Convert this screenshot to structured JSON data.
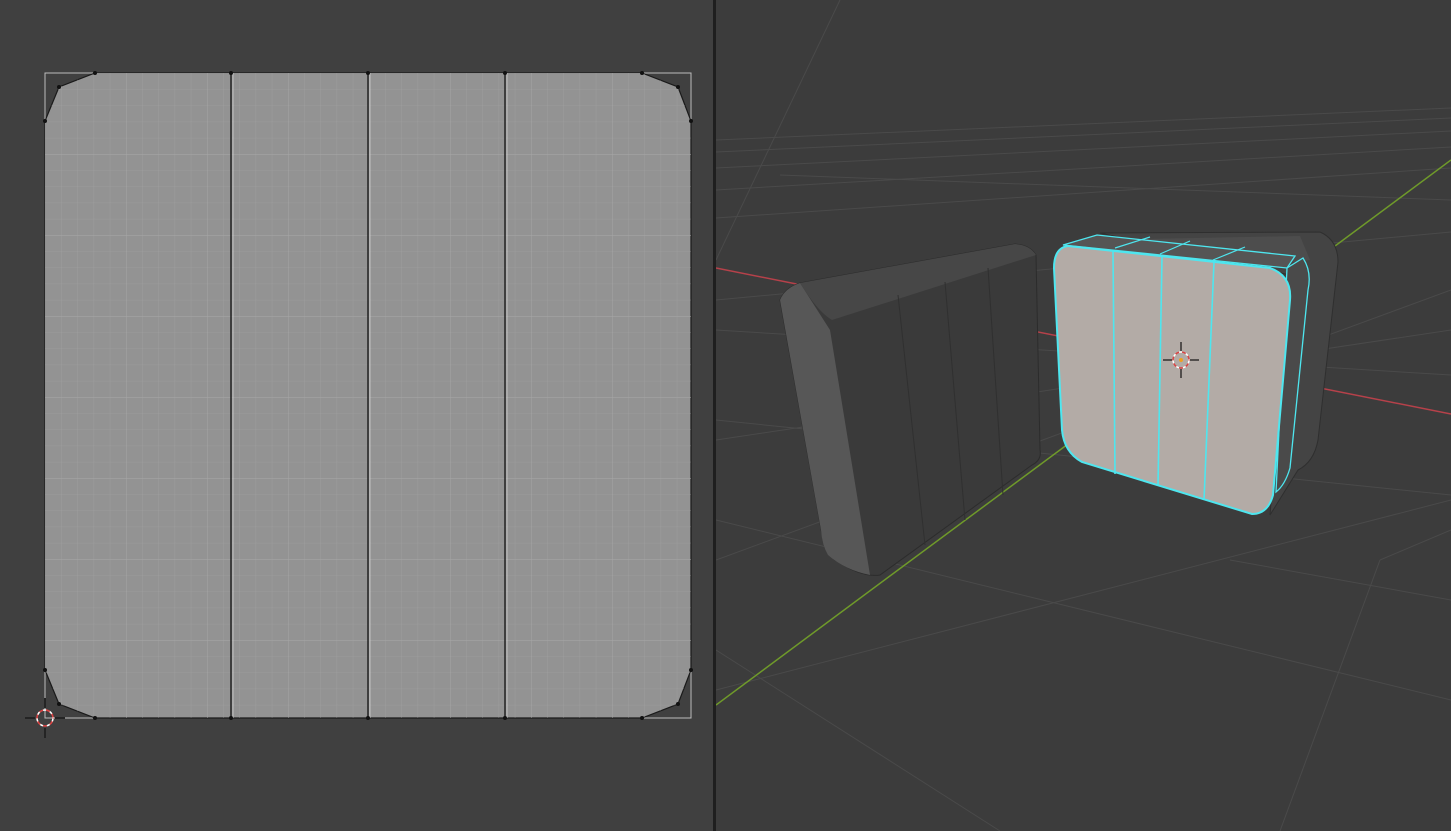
{
  "editors": {
    "uv": {
      "type": "UV Editor"
    },
    "viewport": {
      "type": "3D Viewport"
    }
  },
  "icons": {
    "uv_cursor": "cursor-crosshair-icon",
    "viewport_origin": "object-origin-icon"
  },
  "colors": {
    "background_uv": "#404040",
    "background_viewport": "#3c3c3c",
    "uv_face_fill": "#939393",
    "uv_edge": "#1a1a1a",
    "selection_edge": "#4ee6ef",
    "selected_face_tint": "#b3aba6",
    "axis_x": "#b6414a",
    "axis_y": "#6f9a2a",
    "cursor_ring": "#d94343"
  },
  "uv": {
    "island_count": 1,
    "face_columns": 4
  }
}
